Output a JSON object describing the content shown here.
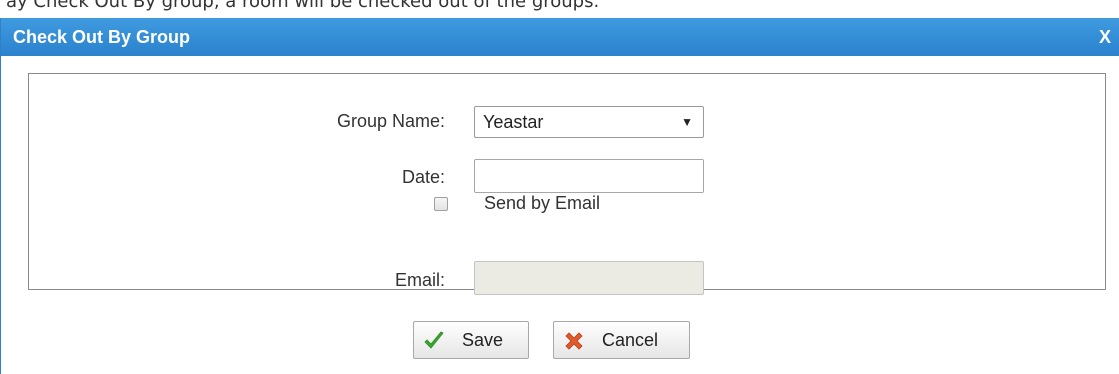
{
  "background_text": "ay Check Out By group, a room will be checked out of the groups.",
  "dialog": {
    "title": "Check Out By Group",
    "close_label": "X"
  },
  "form": {
    "group_name": {
      "label": "Group Name:",
      "selected": "Yeastar"
    },
    "date": {
      "label": "Date:",
      "value": ""
    },
    "send_by_email": {
      "label": "Send by Email",
      "checked": false
    },
    "email": {
      "label": "Email:",
      "value": "",
      "disabled": true
    }
  },
  "buttons": {
    "save": "Save",
    "cancel": "Cancel"
  },
  "colors": {
    "titlebar": "#2a82cd",
    "title_text": "#ffffff",
    "save_icon": "#3aa82e",
    "cancel_icon": "#e05a2b"
  },
  "icons": {
    "save": "check-icon",
    "cancel": "x-icon"
  }
}
